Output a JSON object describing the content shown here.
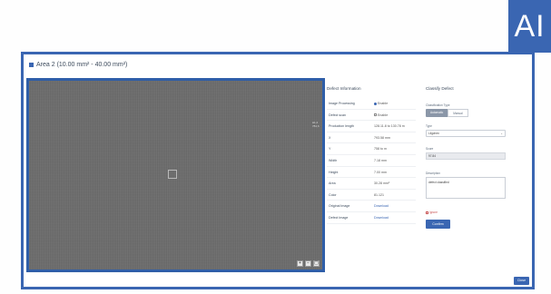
{
  "badge": {
    "text": "AI"
  },
  "modal": {
    "title": "Area 2 (10.00 mm² - 40.00 mm²)"
  },
  "image_viewer": {
    "edge_label": "Δ1,2\n784,6",
    "tools": [
      "zoom-in",
      "zoom-out",
      "fit"
    ]
  },
  "defect_info": {
    "heading": "Defect Information",
    "rows": [
      {
        "key": "Image Processing",
        "value": "Enable",
        "control": "radio"
      },
      {
        "key": "Defect scan",
        "value": "Enable",
        "control": "checkbox"
      },
      {
        "key": "Production length",
        "value": "128.11.8 to 130.78 m",
        "control": ""
      },
      {
        "key": "X",
        "value": "793.58 mm",
        "control": ""
      },
      {
        "key": "Y",
        "value": "758 to m",
        "control": ""
      },
      {
        "key": "Width",
        "value": "7.18 mm",
        "control": ""
      },
      {
        "key": "Height",
        "value": "7.00 mm",
        "control": ""
      },
      {
        "key": "Area",
        "value": "30.28 mm²",
        "control": ""
      },
      {
        "key": "Color",
        "value": "81.121",
        "control": ""
      },
      {
        "key": "Original Image",
        "value": "Download",
        "control": "link"
      },
      {
        "key": "Defect Image",
        "value": "Download",
        "control": "link"
      }
    ]
  },
  "classify": {
    "heading": "Classify Defect",
    "classification_label": "Classification Type",
    "segments": [
      "Automatic",
      "Manual"
    ],
    "type_label": "Type",
    "type_value": "Lilgchen",
    "score_label": "Score",
    "score_value": "97.84",
    "description_label": "Description",
    "description_value": "defect classified",
    "ignore_label": "Ignore",
    "confirm_label": "Confirm"
  },
  "footer": {
    "close_label": "Close"
  },
  "colors": {
    "accent": "#3a66b2",
    "image_bg": "#6c6c6c"
  }
}
